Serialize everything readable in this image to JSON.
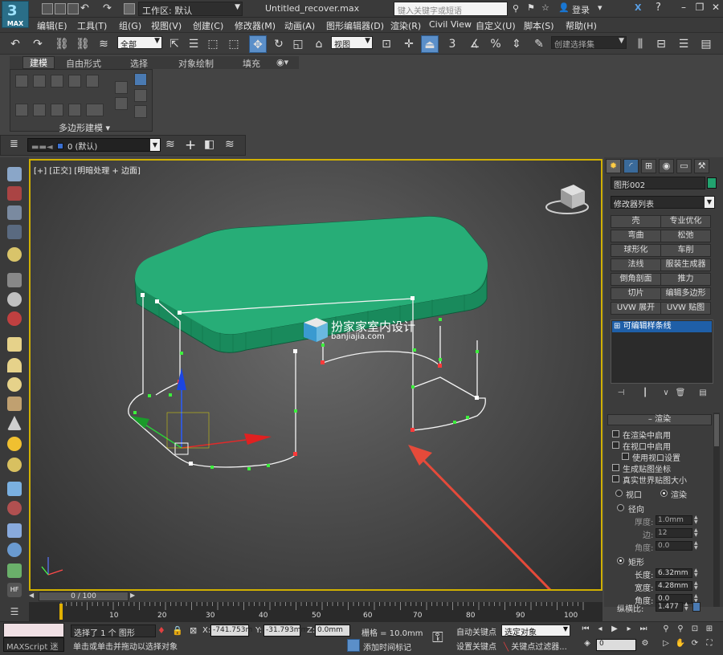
{
  "app": {
    "logo_text": "MAX",
    "workspace_label": "工作区: 默认",
    "title": "Untitled_recover.max",
    "search_placeholder": "键入关键字或短语",
    "login_label": "登录"
  },
  "menu": [
    "编辑(E)",
    "工具(T)",
    "组(G)",
    "视图(V)",
    "创建(C)",
    "修改器(M)",
    "动画(A)",
    "图形编辑器(D)",
    "渲染(R)",
    "Civil View",
    "自定义(U)",
    "脚本(S)",
    "帮助(H)"
  ],
  "toolbar": {
    "selection_filter": "全部",
    "ref_coord": "视图",
    "named_selection": "创建选择集",
    "snap_number": "3"
  },
  "ribbon": {
    "tabs": [
      "建模",
      "自由形式",
      "选择",
      "对象绘制",
      "填充"
    ],
    "panel_label": "多边形建模"
  },
  "layer": {
    "current": "0 (默认)"
  },
  "viewport": {
    "label": "[+] [正交] [明暗处理 + 边面]",
    "watermark_cn": "扮家家室内设计",
    "watermark_url": "banjiajia.com",
    "object_color": "#22a36f"
  },
  "command_panel": {
    "object_name": "图形002",
    "modifier_list": "修改器列表",
    "modifiers": [
      [
        "壳",
        "专业优化"
      ],
      [
        "弯曲",
        "松弛"
      ],
      [
        "球形化",
        "车削"
      ],
      [
        "法线",
        "服装生成器"
      ],
      [
        "倒角剖面",
        "推力"
      ],
      [
        "切片",
        "编辑多边形"
      ],
      [
        "UVW 展开",
        "UVW 贴图"
      ]
    ],
    "stack_item": "可编辑样条线",
    "rollout_title": "渲染",
    "render": {
      "enable_in_render": "在渲染中启用",
      "enable_in_viewport": "在视口中启用",
      "use_viewport_settings": "使用视口设置",
      "gen_mapping": "生成贴图坐标",
      "real_world": "真实世界贴图大小",
      "viewport_radio": "视口",
      "render_radio": "渲染",
      "radial": "径向",
      "thickness_label": "厚度:",
      "thickness": "1.0mm",
      "sides_label": "边:",
      "sides": "12",
      "angle_label": "角度:",
      "angle": "0.0",
      "rectangular": "矩形",
      "length_label": "长度:",
      "length": "6.32mm",
      "width_label": "宽度:",
      "width": "4.28mm",
      "angle2_label": "角度:",
      "angle2": "0.0",
      "aspect_label": "纵横比:",
      "aspect": "1.477"
    }
  },
  "timeline": {
    "frame_label": "0 / 100",
    "ticks": [
      "10",
      "20",
      "30",
      "40",
      "50",
      "60",
      "70",
      "80",
      "90",
      "100"
    ]
  },
  "status": {
    "maxscript": "MAXScript 迷",
    "selected": "选择了 1 个 图形",
    "prompt": "单击或单击并拖动以选择对象",
    "x_label": "X:",
    "x": "-741.753m",
    "y_label": "Y:",
    "y": "-31.793mm",
    "z_label": "Z:",
    "z": "0.0mm",
    "grid": "栅格 = 10.0mm",
    "add_time_tag": "添加时间标记",
    "auto_key": "自动关键点",
    "set_key": "设置关键点",
    "selection_set": "选定对象",
    "key_filters": "关键点过滤器...",
    "frame": "0"
  }
}
